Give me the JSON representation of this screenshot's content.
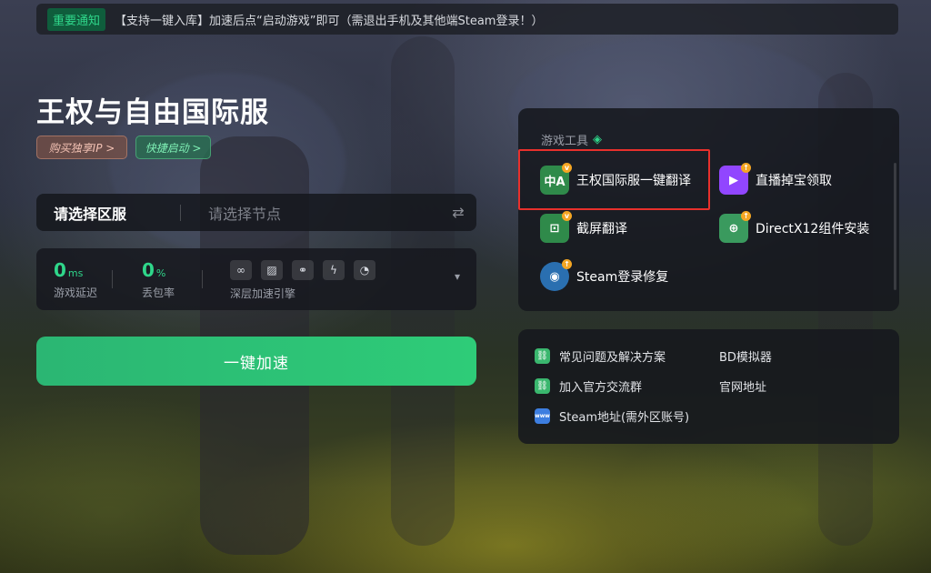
{
  "notice": {
    "tag": "重要通知",
    "text": "【支持一键入库】加速后点“启动游戏”即可（需退出手机及其他端Steam登录！）"
  },
  "game": {
    "title": "王权与自由国际服",
    "buy_ip_label": "购买独享IP >",
    "quick_start_label": "快捷启动 >"
  },
  "server": {
    "region_label": "请选择区服",
    "node_placeholder": "请选择节点",
    "swap_icon": "swap-arrows-icon"
  },
  "stats": {
    "latency": {
      "value": "0",
      "unit": "ms",
      "label": "游戏延迟"
    },
    "packet_loss": {
      "value": "0",
      "unit": "%",
      "label": "丢包率"
    },
    "engine_label": "深层加速引擎",
    "engine_icons": [
      "link-icon",
      "image-icon",
      "share-icon",
      "lightning-icon",
      "gauge-icon"
    ]
  },
  "accelerate_label": "一键加速",
  "tools": {
    "header": "游戏工具",
    "items": [
      {
        "label": "王权国际服一键翻译",
        "icon": "translate-icon",
        "icon_text": "中A"
      },
      {
        "label": "直播掉宝领取",
        "icon": "twitch-icon",
        "icon_text": "▶"
      },
      {
        "label": "截屏翻译",
        "icon": "screenshot-translate-icon",
        "icon_text": "⊡"
      },
      {
        "label": "DirectX12组件安装",
        "icon": "directx-install-icon",
        "icon_text": "⊕"
      },
      {
        "label": "Steam登录修复",
        "icon": "steam-icon",
        "icon_text": "◉"
      }
    ]
  },
  "links": {
    "items": [
      {
        "label": "常见问题及解决方案",
        "icon": "link-icon"
      },
      {
        "label": "BD模拟器",
        "icon": "none"
      },
      {
        "label": "加入官方交流群",
        "icon": "link-icon"
      },
      {
        "label": "官网地址",
        "icon": "none"
      },
      {
        "label": "Steam地址(需外区账号)",
        "icon": "www-icon",
        "icon_text": "www"
      }
    ]
  },
  "colors": {
    "accent_green": "#2fd68a",
    "button_green": "#2ecc78",
    "highlight_red": "#e8302c"
  }
}
